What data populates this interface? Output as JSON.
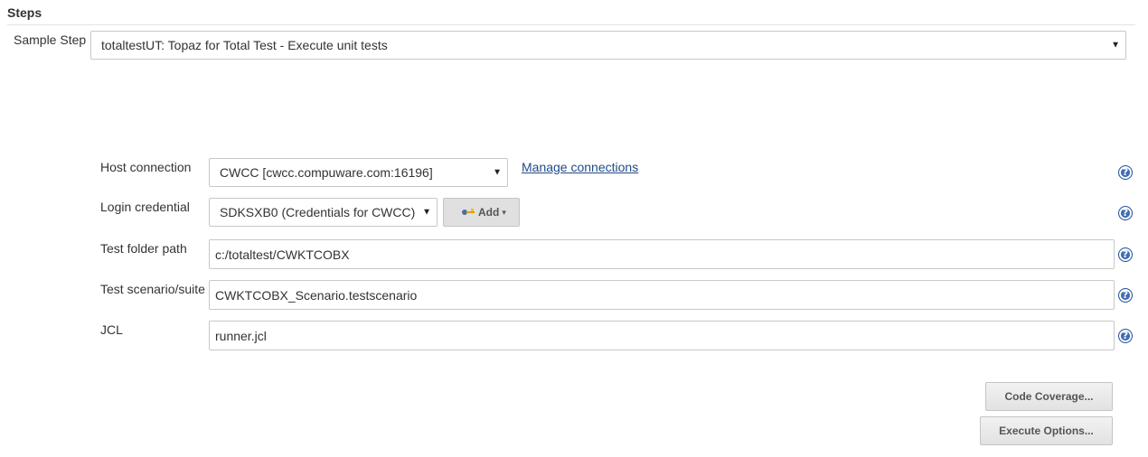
{
  "section": {
    "title": "Steps"
  },
  "sample_step": {
    "label": "Sample Step",
    "selected": "totaltestUT: Topaz for Total Test - Execute unit tests"
  },
  "form": {
    "host_connection": {
      "label": "Host connection",
      "selected": "CWCC [cwcc.compuware.com:16196]",
      "manage_link": "Manage connections"
    },
    "login_credential": {
      "label": "Login credential",
      "selected": "SDKSXB0 (Credentials for CWCC)",
      "add_label": "Add"
    },
    "test_folder_path": {
      "label": "Test folder path",
      "value": "c:/totaltest/CWKTCOBX"
    },
    "test_scenario": {
      "label": "Test scenario/suite",
      "value": "CWKTCOBX_Scenario.testscenario"
    },
    "jcl": {
      "label": "JCL",
      "value": "runner.jcl"
    }
  },
  "buttons": {
    "code_coverage": "Code Coverage...",
    "execute_options": "Execute Options..."
  },
  "icons": {
    "help": "?",
    "dropdown": "▼",
    "caret": "▾"
  },
  "colors": {
    "link": "#204a87",
    "help_icon": "#3e6fb5",
    "border": "#c8c8c8"
  }
}
